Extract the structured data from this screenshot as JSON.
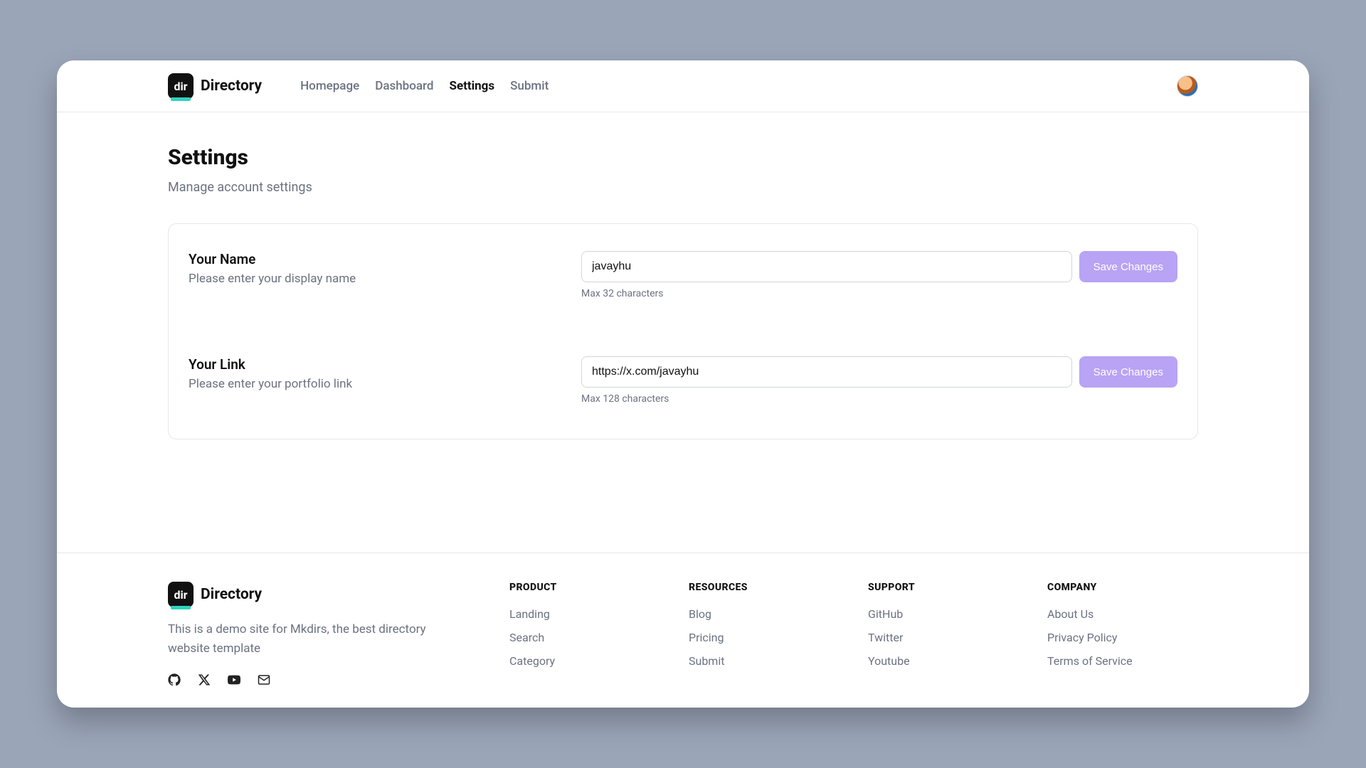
{
  "brand": {
    "badge": "dir",
    "name": "Directory"
  },
  "nav": {
    "items": [
      {
        "label": "Homepage",
        "active": false
      },
      {
        "label": "Dashboard",
        "active": false
      },
      {
        "label": "Settings",
        "active": true
      },
      {
        "label": "Submit",
        "active": false
      }
    ]
  },
  "page": {
    "title": "Settings",
    "subtitle": "Manage account settings"
  },
  "settings": {
    "name": {
      "label": "Your Name",
      "help": "Please enter your display name",
      "value": "javayhu",
      "hint": "Max 32 characters",
      "button": "Save Changes"
    },
    "link": {
      "label": "Your Link",
      "help": "Please enter your portfolio link",
      "value": "https://x.com/javayhu",
      "hint": "Max 128 characters",
      "button": "Save Changes"
    }
  },
  "footer": {
    "description": "This is a demo site for Mkdirs, the best directory website template",
    "columns": [
      {
        "heading": "PRODUCT",
        "links": [
          "Landing",
          "Search",
          "Category"
        ]
      },
      {
        "heading": "RESOURCES",
        "links": [
          "Blog",
          "Pricing",
          "Submit"
        ]
      },
      {
        "heading": "SUPPORT",
        "links": [
          "GitHub",
          "Twitter",
          "Youtube"
        ]
      },
      {
        "heading": "COMPANY",
        "links": [
          "About Us",
          "Privacy Policy",
          "Terms of Service"
        ]
      }
    ]
  }
}
